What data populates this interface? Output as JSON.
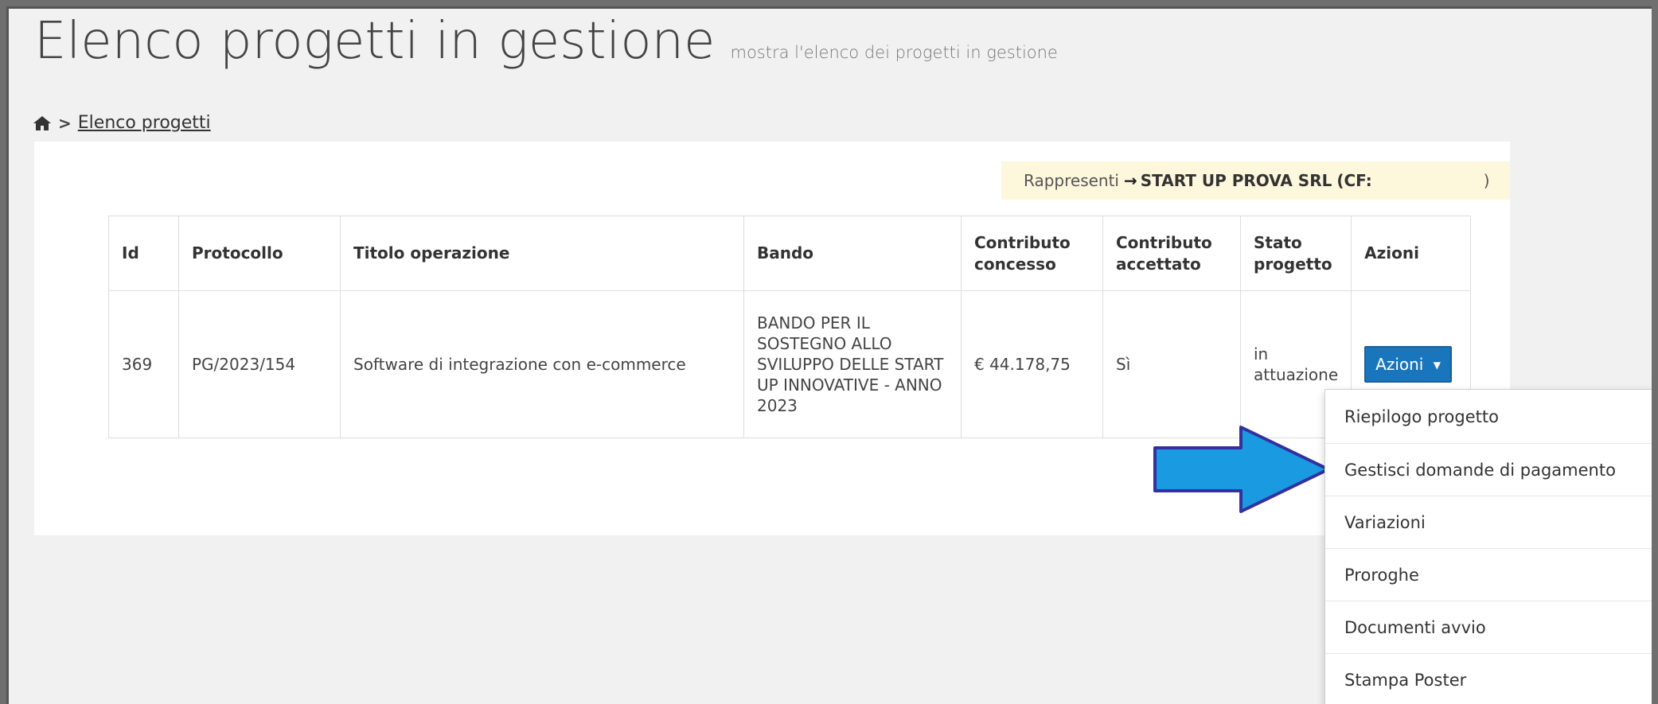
{
  "header": {
    "title": "Elenco progetti in gestione",
    "subtitle": "mostra l'elenco dei progetti in gestione"
  },
  "breadcrumb": {
    "home_icon": "home-icon",
    "separator": ">",
    "current": "Elenco progetti"
  },
  "represent": {
    "label": "Rappresenti",
    "arrow": "→",
    "company": "START UP PROVA SRL",
    "cf_label": "(CF:",
    "cf_close": ")"
  },
  "table": {
    "headers": {
      "id": "Id",
      "protocollo": "Protocollo",
      "titolo": "Titolo operazione",
      "bando": "Bando",
      "contributo_concesso": "Contributo concesso",
      "contributo_accettato": "Contributo accettato",
      "stato": "Stato progetto",
      "azioni": "Azioni"
    },
    "rows": [
      {
        "id": "369",
        "protocollo": "PG/2023/154",
        "titolo": "Software di integrazione con e-commerce",
        "bando": "BANDO PER IL SOSTEGNO ALLO SVILUPPO DELLE START UP INNOVATIVE - ANNO 2023",
        "contributo_concesso": "€ 44.178,75",
        "contributo_accettato": "Sì",
        "stato": "in attuazione",
        "azioni_button": "Azioni"
      }
    ]
  },
  "dropdown": {
    "items": [
      "Riepilogo progetto",
      "Gestisci domande di pagamento",
      "Variazioni",
      "Proroghe",
      "Documenti avvio",
      "Stampa Poster"
    ]
  },
  "colors": {
    "button_bg": "#1976bd",
    "arrow_fill": "#1a9ae0",
    "arrow_stroke": "#3330a0",
    "represent_bg": "#fdf7dc"
  }
}
